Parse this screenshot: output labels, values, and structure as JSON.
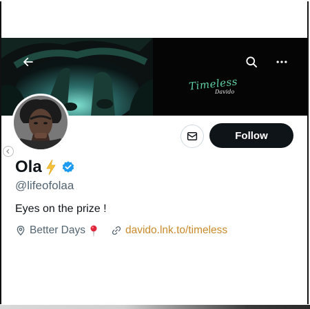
{
  "banner": {
    "script_text": "Timeless",
    "script_sub": "Davido"
  },
  "profile": {
    "display_name": "Ola",
    "handle": "@lifeofolaa",
    "bio": "Eyes on the prize !",
    "location": "Better Days",
    "link": "davido.lnk.to/timeless",
    "verified": true
  },
  "actions": {
    "follow_label": "Follow"
  },
  "icons": {
    "back": "arrow-left-icon",
    "search": "search-icon",
    "more": "more-horizontal-icon",
    "message": "envelope-icon",
    "location": "location-pin-icon",
    "link": "link-icon",
    "verified": "verified-badge-icon",
    "emoji_bolt": "lightning-bolt-emoji",
    "emoji_pin": "round-pushpin-emoji"
  },
  "colors": {
    "follow_button_bg": "#0f1419",
    "verified_blue": "#1d9bf0",
    "link_color": "#c98a2b",
    "secondary_text": "#536471"
  }
}
